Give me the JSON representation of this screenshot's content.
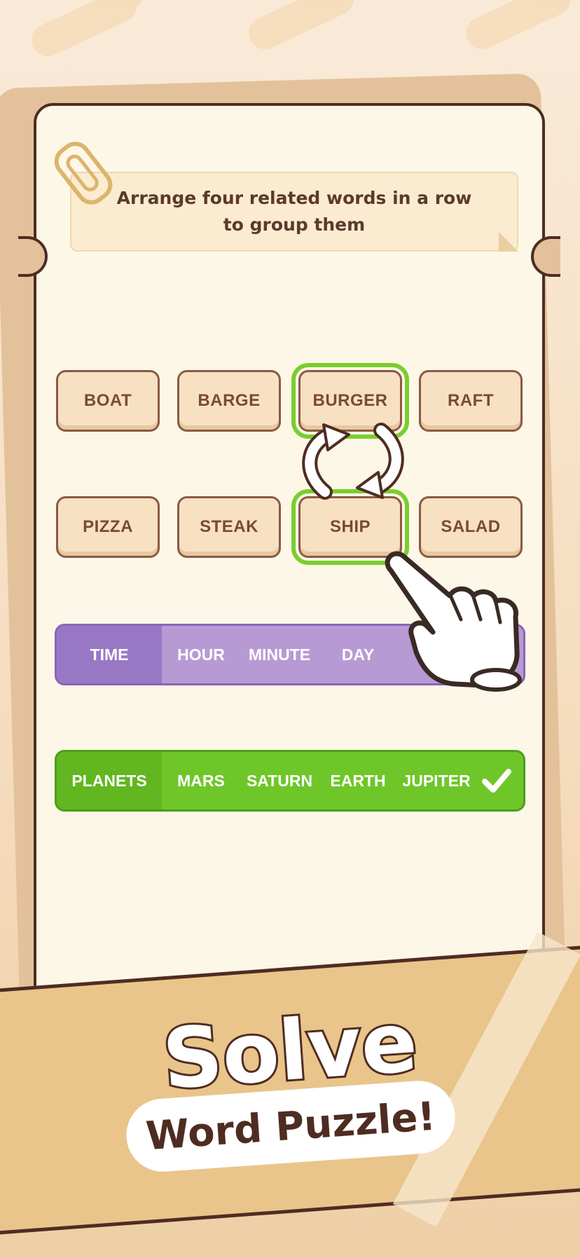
{
  "instruction": "Arrange four related words in a row to group them",
  "tiles": [
    {
      "label": "BOAT"
    },
    {
      "label": "BARGE"
    },
    {
      "label": "BURGER",
      "selected": true
    },
    {
      "label": "RAFT"
    },
    {
      "label": "PIZZA"
    },
    {
      "label": "STEAK"
    },
    {
      "label": "SHIP",
      "selected": true
    },
    {
      "label": "SALAD"
    }
  ],
  "groups": [
    {
      "category": "TIME",
      "words": [
        "HOUR",
        "MINUTE",
        "DAY"
      ],
      "color": "#b79ad3",
      "solved": false
    },
    {
      "category": "PLANETS",
      "words": [
        "MARS",
        "SATURN",
        "EARTH",
        "JUPITER"
      ],
      "color": "#6fc629",
      "solved": true
    }
  ],
  "banner": {
    "title": "Solve",
    "subtitle": "Word Puzzle!"
  },
  "icons": [
    "paperclip-icon",
    "swap-arrows-icon",
    "pointing-hand-icon",
    "checkmark-icon"
  ]
}
